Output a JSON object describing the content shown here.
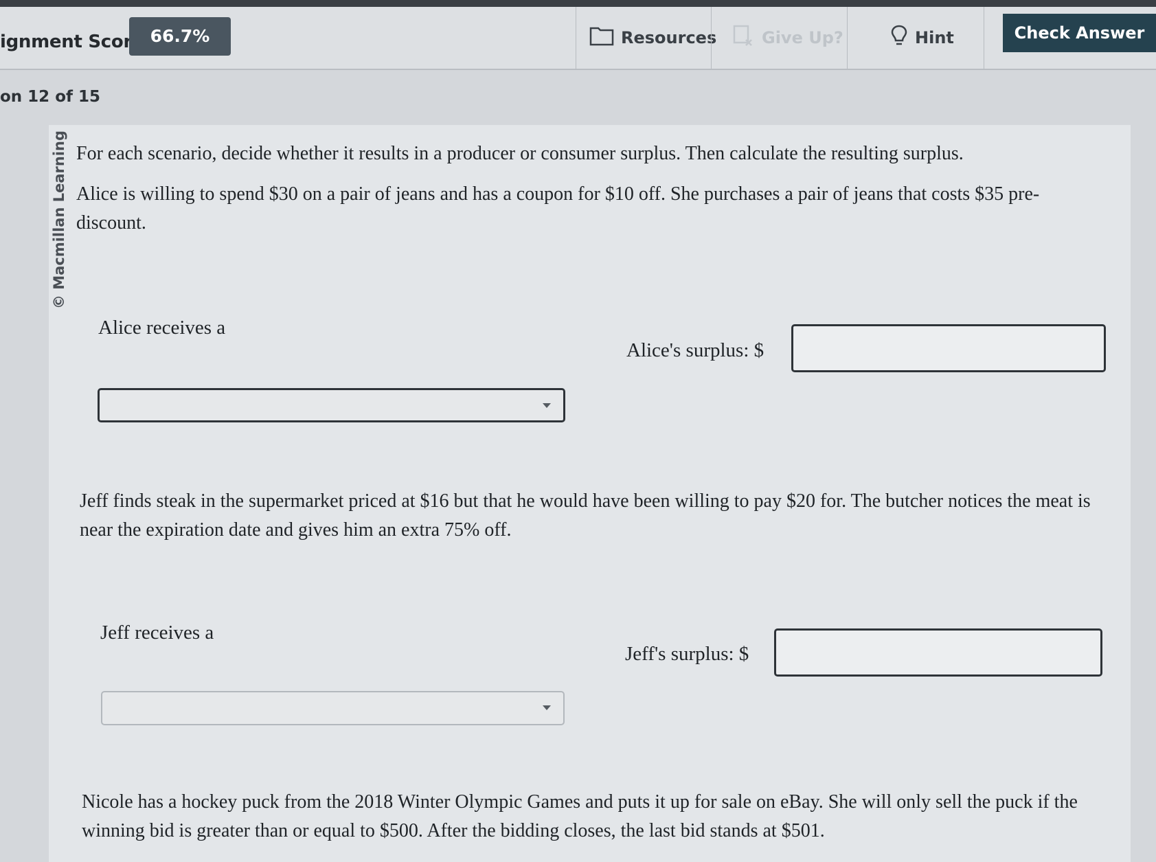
{
  "header": {
    "score_label": "ignment Score:",
    "score_value": "66.7%",
    "resources_label": "Resources",
    "give_up_label": "Give Up?",
    "hint_label": "Hint",
    "check_answer_label": "Check Answer"
  },
  "question_counter": "on 12 of 15",
  "copyright": "© Macmillan Learning",
  "instructions": "For each scenario, decide whether it results in a producer or consumer surplus. Then calculate the resulting surplus.",
  "scenarios": [
    {
      "text": "Alice is willing to spend $30 on a pair of jeans and has a coupon for $10 off. She purchases a pair of jeans that costs $35 pre-discount.",
      "receives_label": "Alice receives a",
      "surplus_label": "Alice's surplus: $",
      "surplus_value": "",
      "dropdown_value": ""
    },
    {
      "text": "Jeff finds steak in the supermarket priced at $16 but that he would have been willing to pay $20 for. The butcher notices the meat is near the expiration date and gives him an extra 75% off.",
      "receives_label": "Jeff receives a",
      "surplus_label": "Jeff's surplus: $",
      "surplus_value": "",
      "dropdown_value": ""
    },
    {
      "text": "Nicole has a hockey puck from the 2018 Winter Olympic Games and puts it up for sale on eBay. She will only sell the puck if the winning bid is greater than or equal to $500. After the bidding closes, the last bid stands at $501."
    }
  ],
  "colors": {
    "check_answer_bg": "#25424f",
    "score_badge_bg": "#4a5660",
    "disabled_text": "#bfc4c9"
  },
  "icons": {
    "resources": "folder-icon",
    "give_up": "give-up-icon",
    "hint": "lightbulb-icon",
    "dropdown": "chevron-down-icon"
  }
}
